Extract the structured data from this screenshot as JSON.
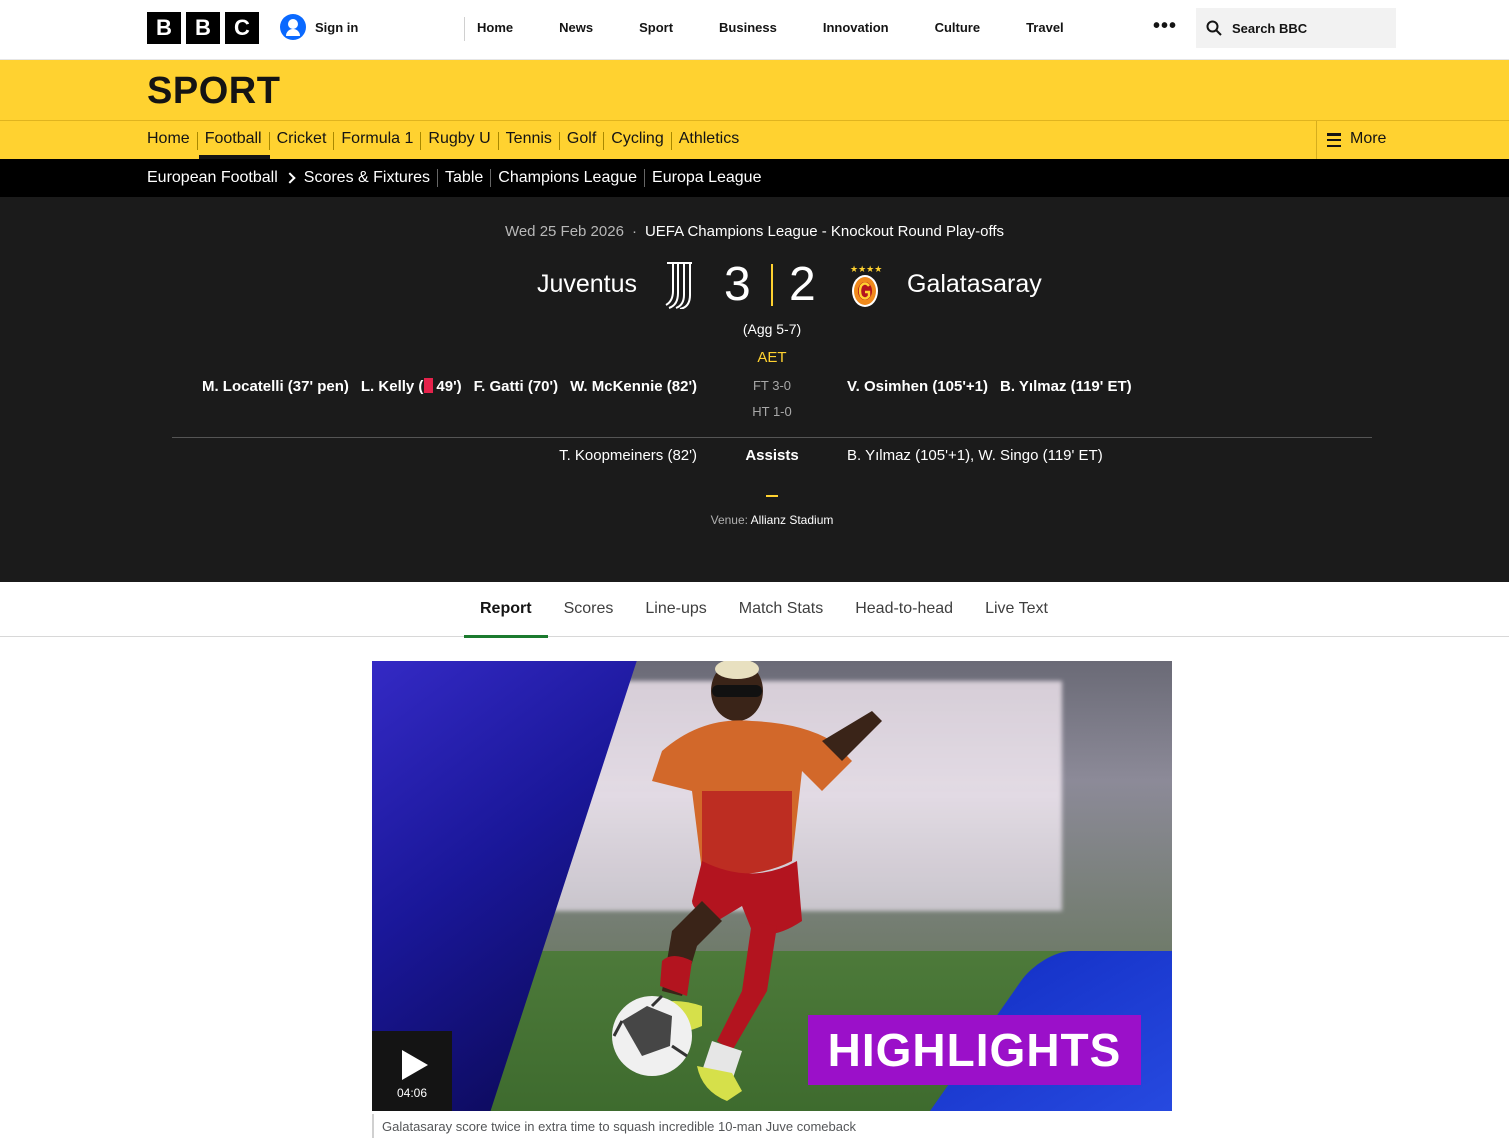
{
  "header": {
    "logo_letters": [
      "B",
      "B",
      "C"
    ],
    "sign_in": "Sign in",
    "nav": [
      "Home",
      "News",
      "Sport",
      "Business",
      "Innovation",
      "Culture",
      "Travel"
    ],
    "more_dots": "•••",
    "search_placeholder": "Search BBC"
  },
  "sport": {
    "title": "SPORT",
    "nav": [
      "Home",
      "Football",
      "Cricket",
      "Formula 1",
      "Rugby U",
      "Tennis",
      "Golf",
      "Cycling",
      "Athletics"
    ],
    "active": "Football",
    "more": "More"
  },
  "subnav": {
    "parent": "European Football",
    "items": [
      "Scores & Fixtures",
      "Table",
      "Champions League",
      "Europa League"
    ]
  },
  "match": {
    "date": "Wed 25 Feb 2026",
    "competition": "UEFA Champions League - Knockout Round Play-offs",
    "home_team": "Juventus",
    "away_team": "Galatasaray",
    "home_score": "3",
    "away_score": "2",
    "aggregate": "(Agg 5-7)",
    "status": "AET",
    "full_time": "FT 3-0",
    "half_time": "HT 1-0",
    "home_events": {
      "e1": "M. Locatelli (37' pen)",
      "e2_player": "L. Kelly (",
      "e2_time": "49')",
      "e3": "F. Gatti (70')",
      "e4": "W. McKennie (82')"
    },
    "away_events": [
      "V. Osimhen (105'+1)",
      "B. Yılmaz (119' ET)"
    ],
    "assists_label": "Assists",
    "home_assists": "T. Koopmeiners (82')",
    "away_assists": "B. Yılmaz (105'+1), W. Singo (119' ET)",
    "venue_label": "Venue:",
    "venue": "Allianz Stadium",
    "colors": {
      "accent": "#ffd230",
      "red_card": "#e5224b",
      "panel": "#1b1b1b"
    }
  },
  "tabs": [
    "Report",
    "Scores",
    "Line-ups",
    "Match Stats",
    "Head-to-head",
    "Live Text"
  ],
  "active_tab": "Report",
  "media": {
    "overlay_text": "HIGHLIGHTS",
    "duration": "04:06",
    "caption": "Galatasaray score twice in extra time to squash incredible 10-man Juve comeback"
  }
}
